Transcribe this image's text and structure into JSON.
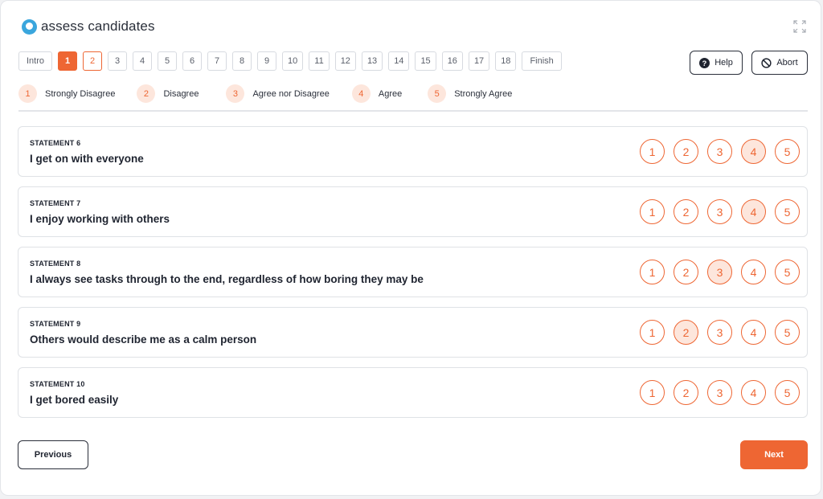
{
  "app": {
    "logo_text": "assess candidates"
  },
  "stepper": {
    "items": [
      "Intro",
      "1",
      "2",
      "3",
      "4",
      "5",
      "6",
      "7",
      "8",
      "9",
      "10",
      "11",
      "12",
      "13",
      "14",
      "15",
      "16",
      "17",
      "18",
      "Finish"
    ],
    "active": "1",
    "visited": [
      "2"
    ]
  },
  "help_label": "Help",
  "abort_label": "Abort",
  "legend": [
    {
      "num": "1",
      "label": "Strongly Disagree"
    },
    {
      "num": "2",
      "label": "Disagree"
    },
    {
      "num": "3",
      "label": "Agree nor Disagree"
    },
    {
      "num": "4",
      "label": "Agree"
    },
    {
      "num": "5",
      "label": "Strongly Agree"
    }
  ],
  "options": [
    "1",
    "2",
    "3",
    "4",
    "5"
  ],
  "statements": [
    {
      "label": "STATEMENT 6",
      "text": "I get on with everyone",
      "selected": "4"
    },
    {
      "label": "STATEMENT 7",
      "text": "I enjoy working with others",
      "selected": "4"
    },
    {
      "label": "STATEMENT 8",
      "text": "I always see tasks through to the end, regardless of how boring they may be",
      "selected": "3"
    },
    {
      "label": "STATEMENT 9",
      "text": "Others would describe me as a calm person",
      "selected": "2"
    },
    {
      "label": "STATEMENT 10",
      "text": "I get bored easily",
      "selected": null
    }
  ],
  "previous_label": "Previous",
  "next_label": "Next",
  "colors": {
    "accent": "#ee6633",
    "accent_light": "#fde6dc",
    "logo": "#3aa6dd"
  },
  "icons": {
    "help": "question-circle-icon",
    "abort": "no-entry-icon",
    "expand": "expand-icon"
  }
}
